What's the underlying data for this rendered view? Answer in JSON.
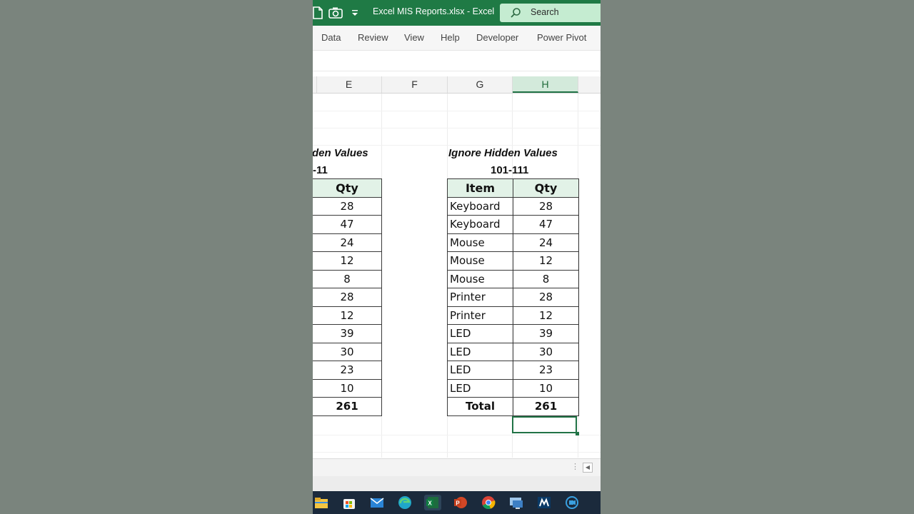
{
  "window": {
    "title": "Excel MIS Reports.xlsx  -  Excel",
    "search_label": "Search"
  },
  "ribbon": {
    "tabs": [
      "Data",
      "Review",
      "View",
      "Help",
      "Developer",
      "Power Pivot"
    ]
  },
  "columns": [
    "E",
    "F",
    "G",
    "H"
  ],
  "selected_column": "H",
  "left_table": {
    "heading": "den Values",
    "range": "-11",
    "qty_header": "Qty",
    "rows": [
      "28",
      "47",
      "24",
      "12",
      "8",
      "28",
      "12",
      "39",
      "30",
      "23",
      "10"
    ],
    "total": "261"
  },
  "right_table": {
    "heading": "Ignore Hidden Values",
    "range": "101-111",
    "headers": [
      "Item",
      "Qty"
    ],
    "rows": [
      [
        "Keyboard",
        "28"
      ],
      [
        "Keyboard",
        "47"
      ],
      [
        "Mouse",
        "24"
      ],
      [
        "Mouse",
        "12"
      ],
      [
        "Mouse",
        "8"
      ],
      [
        "Printer",
        "28"
      ],
      [
        "Printer",
        "12"
      ],
      [
        "LED",
        "39"
      ],
      [
        "LED",
        "30"
      ],
      [
        "LED",
        "23"
      ],
      [
        "LED",
        "10"
      ]
    ],
    "total_label": "Total",
    "total": "261"
  },
  "taskbar": {
    "icons": [
      "file-explorer-icon",
      "microsoft-store-icon",
      "mail-icon",
      "edge-icon",
      "excel-icon",
      "powerpoint-icon",
      "chrome-icon",
      "remote-desktop-icon",
      "app-m-icon",
      "screen-recorder-icon"
    ],
    "active": "excel-icon"
  },
  "colors": {
    "title_bar": "#1f7a45",
    "search_box": "#c5ecd1",
    "header_fill": "#e2f2e7",
    "selection": "#217346",
    "taskbar": "#1b2a3c",
    "backdrop": "#7a847d"
  }
}
